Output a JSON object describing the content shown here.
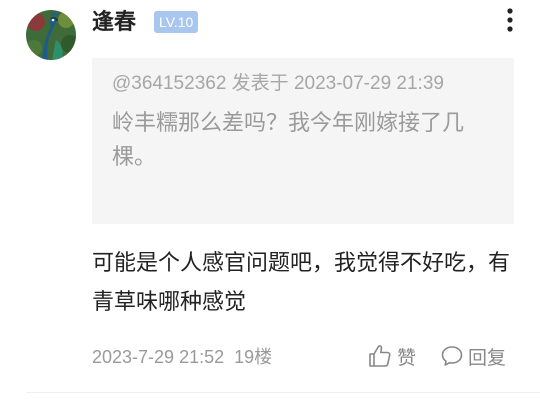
{
  "post": {
    "author": {
      "name": "逢春",
      "level": "LV.10"
    },
    "quote": {
      "meta": "@364152362 发表于 2023-07-29 21:39",
      "text": "岭丰糯那么差吗？我今年刚嫁接了几棵。"
    },
    "content": "可能是个人感官问题吧，我觉得不好吃，有青草味哪种感觉",
    "timestamp": "2023-7-29 21:52",
    "floor": "19楼",
    "actions": {
      "like_label": "赞",
      "reply_label": "回复"
    }
  },
  "colors": {
    "badge_bg": "#a9c6ee",
    "quote_bg": "#f5f5f5",
    "muted_text": "#9a9a9a"
  },
  "icons": [
    "more-vertical-icon",
    "thumbs-up-icon",
    "comment-bubble-icon"
  ]
}
